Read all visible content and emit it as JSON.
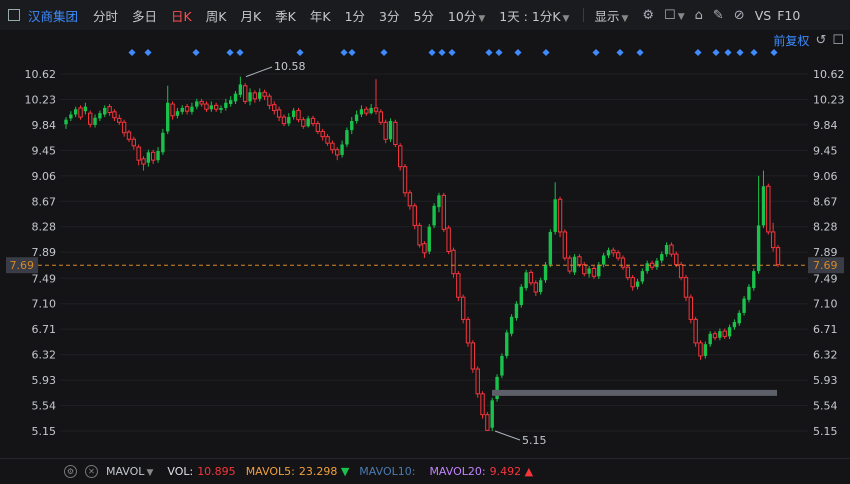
{
  "toolbar": {
    "stock_name": "汉商集团",
    "periods": [
      "分时",
      "多日",
      "日K",
      "周K",
      "月K",
      "季K",
      "年K",
      "1分",
      "3分",
      "5分",
      "10分"
    ],
    "active_period": "日K",
    "range_select": "1天 : 1分K",
    "display": "显示",
    "vs": "VS",
    "f10": "F10"
  },
  "chart": {
    "restoration": "前复权",
    "y_ticks": [
      "10.62",
      "10.23",
      "9.84",
      "9.45",
      "9.06",
      "8.67",
      "8.28",
      "7.89",
      "7.49",
      "7.10",
      "6.71",
      "6.32",
      "5.93",
      "5.54",
      "5.15"
    ],
    "current_price": "7.69",
    "annotations": {
      "high": "10.58",
      "low": "5.15"
    },
    "colors": {
      "up": "#f5353c",
      "down": "#19c24a",
      "accent": "#3d8bfd",
      "price_line": "#d7882c"
    }
  },
  "chart_data": {
    "type": "candlestick",
    "ylim": [
      5.0,
      10.8
    ],
    "current_price": 7.69,
    "high": 10.58,
    "low": 5.15,
    "candles": [
      [
        9.92,
        9.85,
        9.96,
        9.78
      ],
      [
        10.0,
        9.94,
        10.05,
        9.9
      ],
      [
        10.08,
        10.0,
        10.12,
        9.96
      ],
      [
        9.96,
        10.1,
        10.14,
        9.92
      ],
      [
        10.12,
        10.05,
        10.18,
        10.0
      ],
      [
        9.85,
        10.02,
        10.06,
        9.8
      ],
      [
        9.95,
        9.84,
        10.0,
        9.8
      ],
      [
        10.02,
        9.94,
        10.06,
        9.9
      ],
      [
        10.1,
        10.0,
        10.14,
        9.96
      ],
      [
        10.03,
        10.12,
        10.16,
        9.98
      ],
      [
        9.95,
        10.04,
        10.08,
        9.9
      ],
      [
        9.88,
        9.94,
        10.0,
        9.84
      ],
      [
        9.72,
        9.88,
        9.92,
        9.66
      ],
      [
        9.62,
        9.73,
        9.76,
        9.58
      ],
      [
        9.52,
        9.62,
        9.66,
        9.46
      ],
      [
        9.3,
        9.5,
        9.54,
        9.22
      ],
      [
        9.24,
        9.32,
        9.36,
        9.14
      ],
      [
        9.42,
        9.26,
        9.46,
        9.2
      ],
      [
        9.3,
        9.42,
        9.46,
        9.24
      ],
      [
        9.44,
        9.3,
        9.5,
        9.26
      ],
      [
        9.72,
        9.42,
        9.78,
        9.38
      ],
      [
        10.18,
        9.74,
        10.44,
        9.7
      ],
      [
        9.98,
        10.16,
        10.2,
        9.92
      ],
      [
        10.05,
        9.98,
        10.1,
        9.94
      ],
      [
        10.1,
        10.04,
        10.14,
        10.0
      ],
      [
        10.05,
        10.12,
        10.16,
        10.0
      ],
      [
        10.12,
        10.04,
        10.18,
        10.0
      ],
      [
        10.2,
        10.12,
        10.24,
        10.08
      ],
      [
        10.16,
        10.2,
        10.24,
        10.12
      ],
      [
        10.08,
        10.16,
        10.2,
        10.04
      ],
      [
        10.14,
        10.08,
        10.2,
        10.04
      ],
      [
        10.08,
        10.14,
        10.18,
        10.04
      ],
      [
        10.1,
        10.07,
        10.14,
        10.02
      ],
      [
        10.18,
        10.1,
        10.24,
        10.06
      ],
      [
        10.22,
        10.16,
        10.28,
        10.12
      ],
      [
        10.32,
        10.2,
        10.36,
        10.16
      ],
      [
        10.46,
        10.3,
        10.58,
        10.26
      ],
      [
        10.2,
        10.44,
        10.48,
        10.16
      ],
      [
        10.34,
        10.2,
        10.4,
        10.14
      ],
      [
        10.24,
        10.33,
        10.37,
        10.18
      ],
      [
        10.34,
        10.24,
        10.4,
        10.2
      ],
      [
        10.28,
        10.34,
        10.38,
        10.22
      ],
      [
        10.14,
        10.28,
        10.32,
        10.08
      ],
      [
        10.06,
        10.15,
        10.2,
        10.0
      ],
      [
        9.96,
        10.07,
        10.12,
        9.9
      ],
      [
        9.86,
        9.96,
        10.0,
        9.82
      ],
      [
        9.96,
        9.86,
        10.02,
        9.82
      ],
      [
        10.06,
        9.96,
        10.1,
        9.92
      ],
      [
        9.92,
        10.06,
        10.1,
        9.88
      ],
      [
        9.82,
        9.92,
        9.96,
        9.78
      ],
      [
        9.94,
        9.82,
        9.98,
        9.8
      ],
      [
        9.86,
        9.94,
        9.98,
        9.82
      ],
      [
        9.74,
        9.86,
        9.9,
        9.7
      ],
      [
        9.66,
        9.74,
        9.78,
        9.6
      ],
      [
        9.56,
        9.66,
        9.7,
        9.52
      ],
      [
        9.46,
        9.56,
        9.6,
        9.4
      ],
      [
        9.38,
        9.46,
        9.5,
        9.3
      ],
      [
        9.54,
        9.38,
        9.6,
        9.34
      ],
      [
        9.76,
        9.54,
        9.8,
        9.5
      ],
      [
        9.9,
        9.76,
        9.96,
        9.7
      ],
      [
        10.0,
        9.9,
        10.06,
        9.86
      ],
      [
        10.08,
        10.0,
        10.14,
        9.96
      ],
      [
        10.02,
        10.08,
        10.12,
        9.98
      ],
      [
        10.1,
        10.02,
        10.16,
        10.0
      ],
      [
        10.05,
        10.1,
        10.54,
        10.0
      ],
      [
        9.88,
        10.04,
        10.08,
        9.84
      ],
      [
        9.62,
        9.88,
        9.92,
        9.56
      ],
      [
        9.9,
        9.62,
        9.94,
        9.58
      ],
      [
        9.54,
        9.88,
        9.92,
        9.5
      ],
      [
        9.2,
        9.52,
        9.56,
        9.14
      ],
      [
        8.8,
        9.2,
        9.24,
        8.74
      ],
      [
        8.6,
        8.8,
        8.84,
        8.54
      ],
      [
        8.3,
        8.6,
        8.64,
        8.24
      ],
      [
        8.0,
        8.3,
        8.34,
        7.96
      ],
      [
        7.88,
        8.02,
        8.06,
        7.8
      ],
      [
        8.28,
        7.9,
        8.32,
        7.86
      ],
      [
        8.6,
        8.3,
        8.64,
        8.26
      ],
      [
        8.76,
        8.58,
        8.8,
        8.5
      ],
      [
        8.24,
        8.76,
        8.8,
        8.2
      ],
      [
        7.9,
        8.26,
        8.3,
        7.86
      ],
      [
        7.56,
        7.92,
        7.96,
        7.5
      ],
      [
        7.2,
        7.56,
        7.6,
        7.14
      ],
      [
        6.86,
        7.2,
        7.24,
        6.8
      ],
      [
        6.5,
        6.86,
        6.9,
        6.44
      ],
      [
        6.1,
        6.5,
        6.54,
        6.04
      ],
      [
        5.72,
        6.1,
        6.14,
        5.66
      ],
      [
        5.4,
        5.72,
        5.76,
        5.34
      ],
      [
        5.16,
        5.4,
        5.44,
        5.15
      ],
      [
        5.62,
        5.2,
        5.66,
        5.15
      ],
      [
        5.98,
        5.64,
        6.02,
        5.6
      ],
      [
        6.3,
        6.0,
        6.34,
        5.96
      ],
      [
        6.66,
        6.3,
        6.7,
        6.26
      ],
      [
        6.9,
        6.64,
        6.94,
        6.6
      ],
      [
        7.1,
        6.88,
        7.14,
        6.84
      ],
      [
        7.36,
        7.08,
        7.4,
        7.04
      ],
      [
        7.58,
        7.34,
        7.62,
        7.3
      ],
      [
        7.42,
        7.58,
        7.62,
        7.38
      ],
      [
        7.28,
        7.42,
        7.46,
        7.22
      ],
      [
        7.46,
        7.28,
        7.5,
        7.24
      ],
      [
        7.7,
        7.46,
        7.74,
        7.42
      ],
      [
        8.2,
        7.7,
        8.24,
        7.66
      ],
      [
        8.7,
        8.2,
        8.96,
        8.16
      ],
      [
        8.2,
        8.7,
        8.74,
        8.12
      ],
      [
        7.8,
        8.2,
        8.24,
        7.76
      ],
      [
        7.6,
        7.8,
        7.84,
        7.56
      ],
      [
        7.82,
        7.58,
        7.86,
        7.54
      ],
      [
        7.7,
        7.82,
        7.86,
        7.66
      ],
      [
        7.56,
        7.7,
        7.74,
        7.52
      ],
      [
        7.64,
        7.56,
        7.68,
        7.5
      ],
      [
        7.52,
        7.64,
        7.68,
        7.48
      ],
      [
        7.7,
        7.52,
        7.74,
        7.48
      ],
      [
        7.84,
        7.7,
        7.88,
        7.66
      ],
      [
        7.92,
        7.84,
        7.96,
        7.8
      ],
      [
        7.88,
        7.92,
        7.96,
        7.82
      ],
      [
        7.8,
        7.88,
        7.92,
        7.76
      ],
      [
        7.66,
        7.8,
        7.84,
        7.62
      ],
      [
        7.5,
        7.66,
        7.7,
        7.46
      ],
      [
        7.36,
        7.5,
        7.54,
        7.3
      ],
      [
        7.44,
        7.36,
        7.48,
        7.32
      ],
      [
        7.6,
        7.44,
        7.64,
        7.4
      ],
      [
        7.72,
        7.6,
        7.76,
        7.56
      ],
      [
        7.66,
        7.72,
        7.76,
        7.62
      ],
      [
        7.76,
        7.66,
        7.8,
        7.62
      ],
      [
        7.86,
        7.76,
        7.9,
        7.72
      ],
      [
        8.0,
        7.86,
        8.04,
        7.82
      ],
      [
        7.86,
        8.0,
        8.04,
        7.82
      ],
      [
        7.7,
        7.86,
        7.9,
        7.66
      ],
      [
        7.5,
        7.7,
        7.74,
        7.46
      ],
      [
        7.2,
        7.5,
        7.54,
        7.14
      ],
      [
        6.86,
        7.2,
        7.24,
        6.8
      ],
      [
        6.5,
        6.86,
        6.9,
        6.44
      ],
      [
        6.3,
        6.5,
        6.54,
        6.24
      ],
      [
        6.48,
        6.3,
        6.52,
        6.26
      ],
      [
        6.64,
        6.48,
        6.68,
        6.44
      ],
      [
        6.58,
        6.64,
        6.68,
        6.54
      ],
      [
        6.68,
        6.58,
        6.72,
        6.54
      ],
      [
        6.6,
        6.68,
        6.72,
        6.56
      ],
      [
        6.74,
        6.6,
        6.78,
        6.56
      ],
      [
        6.82,
        6.74,
        6.86,
        6.7
      ],
      [
        6.96,
        6.8,
        7.0,
        6.76
      ],
      [
        7.18,
        6.96,
        7.22,
        6.92
      ],
      [
        7.36,
        7.16,
        7.4,
        7.12
      ],
      [
        7.6,
        7.34,
        7.64,
        7.3
      ],
      [
        8.3,
        7.6,
        9.06,
        7.56
      ],
      [
        8.9,
        8.3,
        9.14,
        8.26
      ],
      [
        8.2,
        8.9,
        8.94,
        8.16
      ],
      [
        7.96,
        8.2,
        8.34,
        7.9
      ],
      [
        7.7,
        7.96,
        8.0,
        7.66
      ]
    ]
  },
  "status": {
    "indicator": "MAVOL",
    "vol_label": "VOL:",
    "vol_value": "10.895",
    "ma5_label": "MAVOL5:",
    "ma5_value": "23.298",
    "ma10_label": "MAVOL10:",
    "ma20_label": "MAVOL20:",
    "ma20_value": "9.492"
  }
}
